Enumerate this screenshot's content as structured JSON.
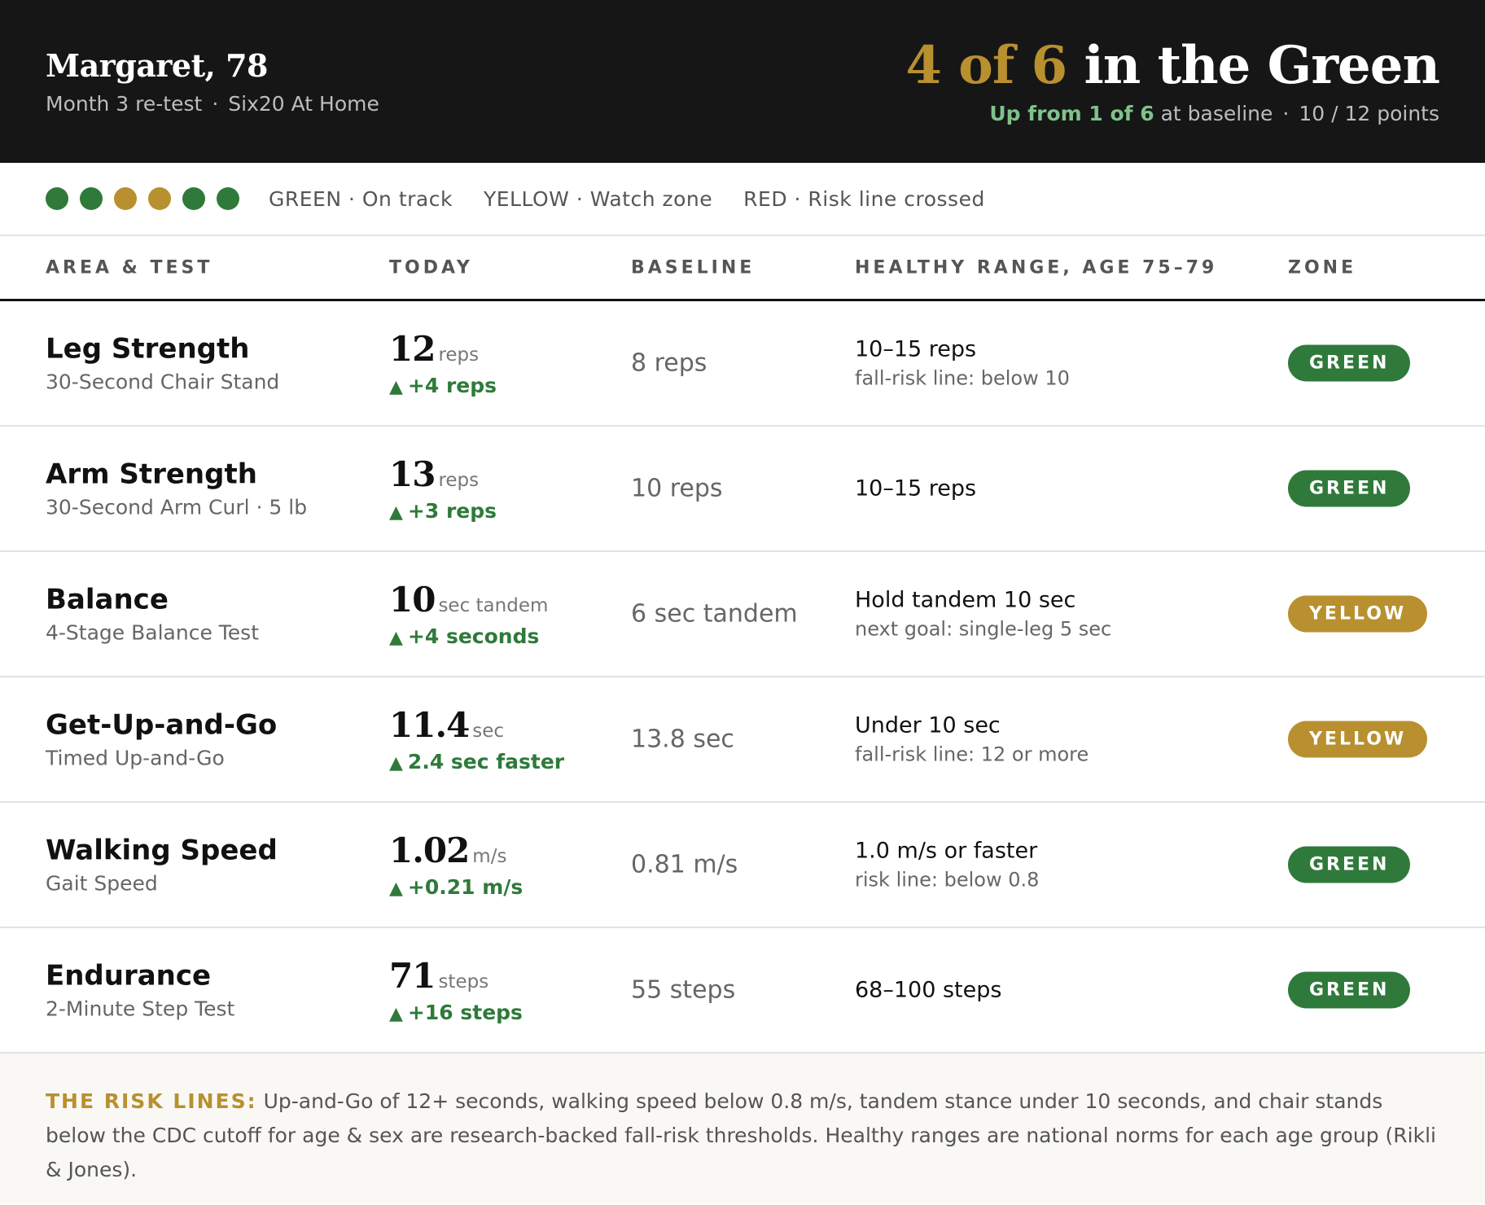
{
  "header": {
    "name": "Margaret, 78",
    "subtitle_1": "Month 3 re-test",
    "subtitle_sep": "·",
    "subtitle_2": "Six20 At Home",
    "score_highlight": "4 of 6",
    "score_rest": " in the Green",
    "up_from": "Up from 1 of 6",
    "at_baseline": " at baseline",
    "points": "10 / 12 points"
  },
  "legend": {
    "dots": [
      "#2f7a3b",
      "#2f7a3b",
      "#b8902f",
      "#b8902f",
      "#2f7a3b",
      "#2f7a3b"
    ],
    "items": [
      "GREEN · On track",
      "YELLOW · Watch zone",
      "RED · Risk line crossed"
    ]
  },
  "columns": [
    "AREA & TEST",
    "TODAY",
    "BASELINE",
    "HEALTHY RANGE, AGE 75–79",
    "ZONE"
  ],
  "colors": {
    "green": "#2f7a3b",
    "yellow": "#b8902f",
    "arrow": "▲"
  },
  "rows": [
    {
      "area": "Leg Strength",
      "test": "30-Second Chair Stand",
      "today": "12",
      "unit": "reps",
      "delta": "+4 reps",
      "baseline": "8 reps",
      "range": "10–15 reps",
      "range_note": "fall-risk line: below 10",
      "zone": "GREEN"
    },
    {
      "area": "Arm Strength",
      "test": "30-Second Arm Curl · 5 lb",
      "today": "13",
      "unit": "reps",
      "delta": "+3 reps",
      "baseline": "10 reps",
      "range": "10–15 reps",
      "range_note": "",
      "zone": "GREEN"
    },
    {
      "area": "Balance",
      "test": "4-Stage Balance Test",
      "today": "10",
      "unit": "sec tandem",
      "delta": "+4 seconds",
      "baseline": "6 sec tandem",
      "range": "Hold tandem 10 sec",
      "range_note": "next goal: single-leg 5 sec",
      "zone": "YELLOW"
    },
    {
      "area": "Get-Up-and-Go",
      "test": "Timed Up-and-Go",
      "today": "11.4",
      "unit": "sec",
      "delta": "2.4 sec faster",
      "baseline": "13.8 sec",
      "range": "Under 10 sec",
      "range_note": "fall-risk line: 12 or more",
      "zone": "YELLOW"
    },
    {
      "area": "Walking Speed",
      "test": "Gait Speed",
      "today": "1.02",
      "unit": "m/s",
      "delta": "+0.21 m/s",
      "baseline": "0.81 m/s",
      "range": "1.0 m/s or faster",
      "range_note": "risk line: below 0.8",
      "zone": "GREEN"
    },
    {
      "area": "Endurance",
      "test": "2-Minute Step Test",
      "today": "71",
      "unit": "steps",
      "delta": "+16 steps",
      "baseline": "55 steps",
      "range": "68–100 steps",
      "range_note": "",
      "zone": "GREEN"
    }
  ],
  "footnote": {
    "lead": "THE RISK LINES:",
    "text": " Up-and-Go of 12+ seconds, walking speed below 0.8 m/s, tandem stance under 10 seconds, and chair stands below the CDC cutoff for age & sex are research-backed fall-risk thresholds. Healthy ranges are national norms for each age group (Rikli & Jones)."
  }
}
